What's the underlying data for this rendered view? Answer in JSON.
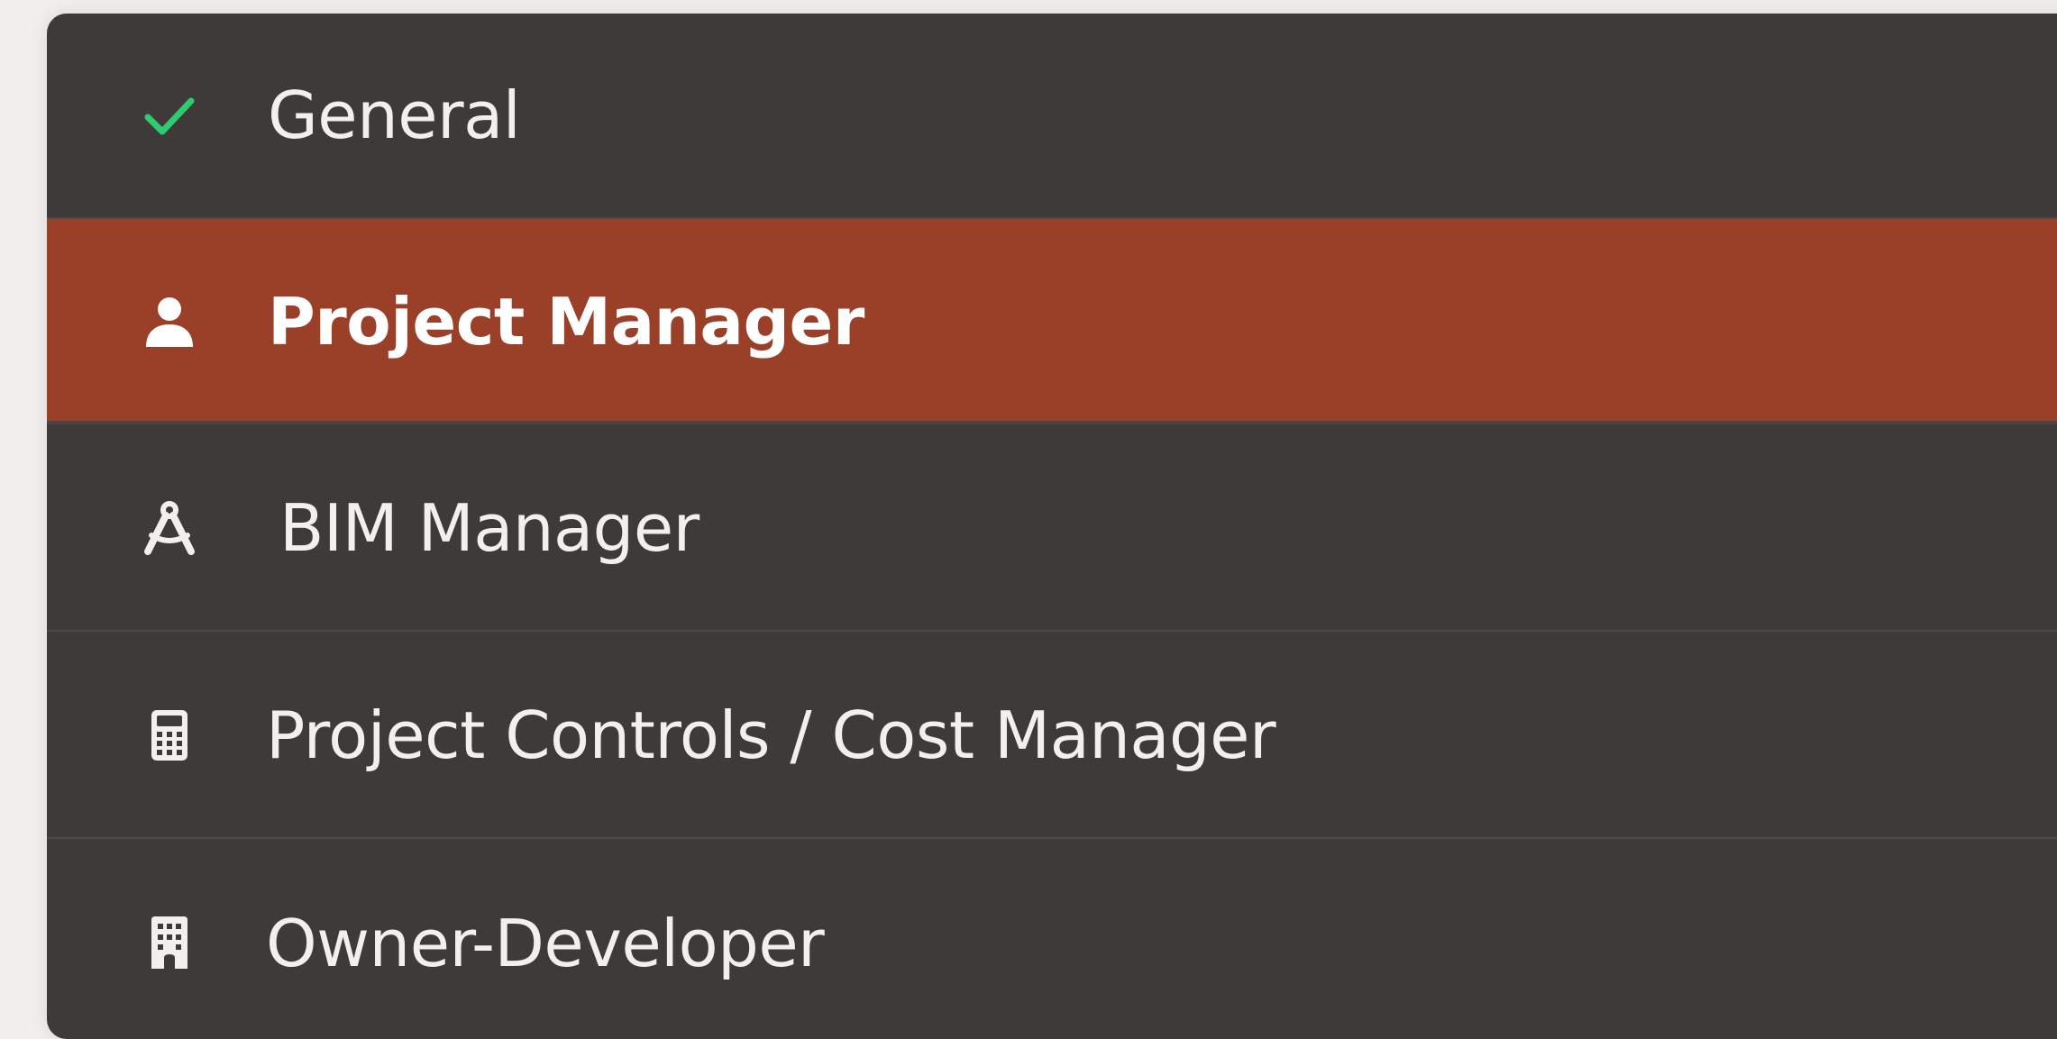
{
  "menu": {
    "items": [
      {
        "label": "General",
        "icon": "check-icon",
        "selected": true,
        "active": false
      },
      {
        "label": "Project Manager",
        "icon": "user-icon",
        "selected": false,
        "active": true
      },
      {
        "label": "BIM Manager",
        "icon": "compass-drafting-icon",
        "selected": false,
        "active": false
      },
      {
        "label": "Project Controls / Cost Manager",
        "icon": "calculator-icon",
        "selected": false,
        "active": false
      },
      {
        "label": "Owner-Developer",
        "icon": "building-icon",
        "selected": false,
        "active": false
      }
    ]
  },
  "colors": {
    "menu_background": "#3d3a39",
    "active_background": "#9a3f28",
    "check": "#2ecc71",
    "text": "#f2f0ee"
  }
}
